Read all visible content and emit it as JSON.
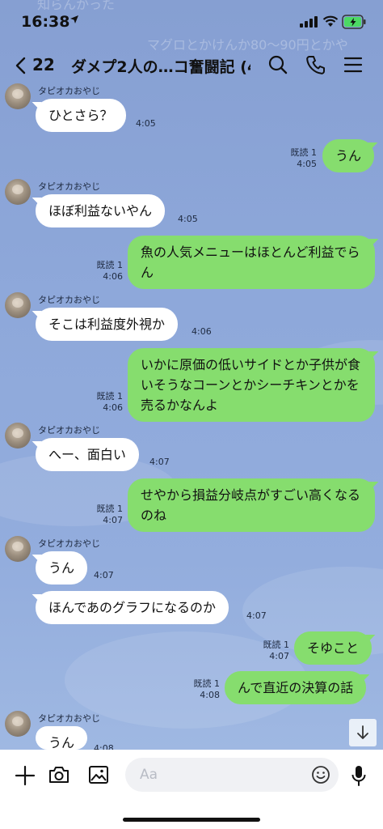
{
  "status_bar": {
    "time": "16:38"
  },
  "background_ghost": [
    "知らんかった",
    "マグロとかけんか80〜90円とかや"
  ],
  "header": {
    "unread_count": "22",
    "title": "ダメプ2人の…コ奮闘記 (4)"
  },
  "messages": [
    {
      "side": "in",
      "sender": "タピオカおやじ",
      "text": "ひとさら？",
      "time": "4:05"
    },
    {
      "side": "out",
      "read": "既読 1",
      "text": "うん",
      "time": "4:05"
    },
    {
      "side": "in",
      "sender": "タピオカおやじ",
      "text": "ほぼ利益ないやん",
      "time": "4:05"
    },
    {
      "side": "out",
      "read": "既読 1",
      "text": "魚の人気メニューはほとんど利益でらん",
      "time": "4:06"
    },
    {
      "side": "in",
      "sender": "タピオカおやじ",
      "text": "そこは利益度外視か",
      "time": "4:06"
    },
    {
      "side": "out",
      "read": "既読 1",
      "text": "いかに原価の低いサイドとか子供が食いそうなコーンとかシーチキンとかを売るかなんよ",
      "time": "4:06"
    },
    {
      "side": "in",
      "sender": "タピオカおやじ",
      "text": "へー、面白い",
      "time": "4:07"
    },
    {
      "side": "out",
      "read": "既読 1",
      "text": "せやから損益分岐点がすごい高くなるのね",
      "time": "4:07"
    },
    {
      "side": "in",
      "sender": "タピオカおやじ",
      "text": "うん",
      "time": "4:07"
    },
    {
      "side": "in",
      "text": "ほんであのグラフになるのか",
      "time": "4:07"
    },
    {
      "side": "out",
      "read": "既読 1",
      "text": "そゆこと",
      "time": "4:07"
    },
    {
      "side": "out",
      "read": "既読 1",
      "text": "んで直近の決算の話",
      "time": "4:08"
    },
    {
      "side": "in",
      "sender": "タピオカおやじ",
      "text": "うん",
      "time": "4:08"
    }
  ],
  "input": {
    "placeholder": "Aa"
  },
  "icons": [
    "location-arrow-icon",
    "signal-icon",
    "wifi-icon",
    "battery-icon",
    "back-chevron-icon",
    "search-icon",
    "phone-icon",
    "menu-icon",
    "avatar",
    "arrow-down-icon",
    "plus-icon",
    "camera-icon",
    "image-icon",
    "emoji-icon",
    "mic-icon"
  ],
  "colors": {
    "chat_background": "#8ea8d8",
    "outgoing_bubble": "#86dd6e",
    "incoming_bubble": "#ffffff",
    "battery_fill": "#4cd964"
  }
}
